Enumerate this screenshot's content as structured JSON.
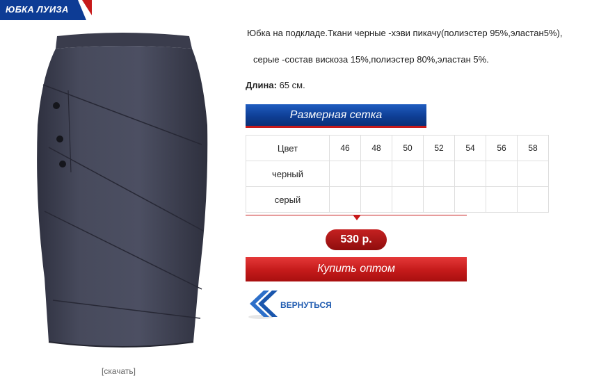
{
  "header": {
    "title": "ЮБКА ЛУИЗА"
  },
  "product": {
    "description_line1": "Юбка на подкладе.Ткани черные -хэви пикачу(полиэстер 95%,эластан5%),",
    "description_line2": "серые -состав вискоза 15%,полиэстер 80%,эластан 5%.",
    "length_label": "Длина:",
    "length_value": "65 см.",
    "download_label": "[скачать]"
  },
  "size_chart": {
    "banner_label": "Размерная сетка",
    "header": [
      "Цвет",
      "46",
      "48",
      "50",
      "52",
      "54",
      "56",
      "58"
    ],
    "rows": [
      {
        "color": "черный",
        "cells": [
          "",
          "",
          "",
          "",
          "",
          "",
          ""
        ]
      },
      {
        "color": "серый",
        "cells": [
          "",
          "",
          "",
          "",
          "",
          "",
          ""
        ]
      }
    ]
  },
  "price": {
    "value": "530 р."
  },
  "actions": {
    "buy_label": "Купить оптом",
    "back_label": "ВЕРНУТЬСЯ"
  },
  "icons": {
    "back": "double-chevron-left-icon"
  },
  "colors": {
    "brand_blue": "#0f3f96",
    "brand_red": "#c71a1a",
    "link_blue": "#1f5bb0"
  }
}
